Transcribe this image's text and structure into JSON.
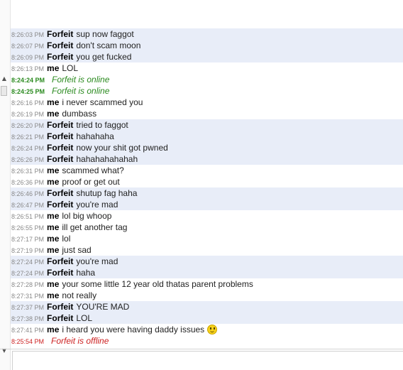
{
  "chat": {
    "messages": [
      {
        "time": "8:26:03 PM",
        "sender": "Forfeit",
        "text": "sup now faggot",
        "type": "msg",
        "band": true
      },
      {
        "time": "8:26:07 PM",
        "sender": "Forfeit",
        "text": "don't scam moon",
        "type": "msg",
        "band": true
      },
      {
        "time": "8:26:09 PM",
        "sender": "Forfeit",
        "text": "you get fucked",
        "type": "msg",
        "band": true
      },
      {
        "time": "8:26:13 PM",
        "sender": "me",
        "text": "LOL",
        "type": "msg",
        "band": false
      },
      {
        "time": "8:24:24 PM",
        "sender": "",
        "text": "Forfeit is online",
        "type": "online",
        "band": false
      },
      {
        "time": "8:24:25 PM",
        "sender": "",
        "text": "Forfeit is online",
        "type": "online",
        "band": false
      },
      {
        "time": "8:26:16 PM",
        "sender": "me",
        "text": "i never scammed you",
        "type": "msg",
        "band": false
      },
      {
        "time": "8:26:19 PM",
        "sender": "me",
        "text": "dumbass",
        "type": "msg",
        "band": false
      },
      {
        "time": "8:26:20 PM",
        "sender": "Forfeit",
        "text": "tried to faggot",
        "type": "msg",
        "band": true
      },
      {
        "time": "8:26:21 PM",
        "sender": "Forfeit",
        "text": "hahahaha",
        "type": "msg",
        "band": true
      },
      {
        "time": "8:26:24 PM",
        "sender": "Forfeit",
        "text": "now your shit got pwned",
        "type": "msg",
        "band": true
      },
      {
        "time": "8:26:26 PM",
        "sender": "Forfeit",
        "text": "hahahahahahah",
        "type": "msg",
        "band": true
      },
      {
        "time": "8:26:31 PM",
        "sender": "me",
        "text": "scammed what?",
        "type": "msg",
        "band": false
      },
      {
        "time": "8:26:36 PM",
        "sender": "me",
        "text": "proof or get out",
        "type": "msg",
        "band": false
      },
      {
        "time": "8:26:46 PM",
        "sender": "Forfeit",
        "text": "shutup fag haha",
        "type": "msg",
        "band": true
      },
      {
        "time": "8:26:47 PM",
        "sender": "Forfeit",
        "text": "you're mad",
        "type": "msg",
        "band": true
      },
      {
        "time": "8:26:51 PM",
        "sender": "me",
        "text": "lol big whoop",
        "type": "msg",
        "band": false
      },
      {
        "time": "8:26:55 PM",
        "sender": "me",
        "text": "ill get another tag",
        "type": "msg",
        "band": false
      },
      {
        "time": "8:27:17 PM",
        "sender": "me",
        "text": "lol",
        "type": "msg",
        "band": false
      },
      {
        "time": "8:27:19 PM",
        "sender": "me",
        "text": "just sad",
        "type": "msg",
        "band": false
      },
      {
        "time": "8:27:24 PM",
        "sender": "Forfeit",
        "text": "you're mad",
        "type": "msg",
        "band": true
      },
      {
        "time": "8:27:24 PM",
        "sender": "Forfeit",
        "text": "haha",
        "type": "msg",
        "band": true
      },
      {
        "time": "8:27:28 PM",
        "sender": "me",
        "text": "your some little 12 year old thatas parent problems",
        "type": "msg",
        "band": false
      },
      {
        "time": "8:27:31 PM",
        "sender": "me",
        "text": "not really",
        "type": "msg",
        "band": false
      },
      {
        "time": "8:27:37 PM",
        "sender": "Forfeit",
        "text": "YOU'RE MAD",
        "type": "msg",
        "band": true
      },
      {
        "time": "8:27:38 PM",
        "sender": "Forfeit",
        "text": "LOL",
        "type": "msg",
        "band": true
      },
      {
        "time": "8:27:41 PM",
        "sender": "me",
        "text": "i heard you were having daddy issues",
        "type": "msg",
        "band": false,
        "emoticon": "smiley-icon"
      },
      {
        "time": "8:25:54 PM",
        "sender": "",
        "text": "Forfeit is offline",
        "type": "offline",
        "band": false
      }
    ]
  },
  "scrollbar": {
    "up_glyph": "▲",
    "down_glyph": "▼"
  },
  "input": {
    "value": ""
  }
}
